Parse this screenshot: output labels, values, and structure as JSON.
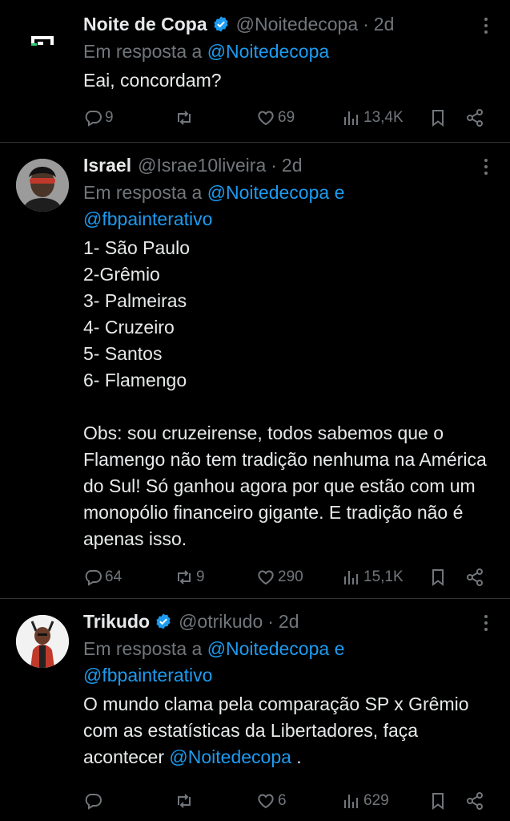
{
  "tweets": [
    {
      "name": "Noite de Copa",
      "verified": true,
      "handle": "@Noitedecopa",
      "time": "2d",
      "reply_prefix": "Em resposta a",
      "reply_mentions": "@Noitedecopa",
      "reply_mentions_2": "",
      "body": "Eai, concordam?",
      "body_mention": "",
      "body_suffix": "",
      "replies": "9",
      "retweets": "",
      "likes": "69",
      "views": "13,4K",
      "avatar_icon": "noite-de-copa-logo"
    },
    {
      "name": "Israel",
      "verified": false,
      "handle": "@Israe10liveira",
      "time": "2d",
      "reply_prefix": "Em resposta a",
      "reply_mentions": "@Noitedecopa e",
      "reply_mentions_2": "@fbpainterativo",
      "body": "1- São Paulo\n2-Grêmio\n3- Palmeiras\n4- Cruzeiro\n5- Santos\n6- Flamengo\n\nObs: sou cruzeirense, todos sabemos que o Flamengo não tem tradição nenhuma na América do Sul! Só ganhou agora por que estão com um monopólio financeiro gigante. E tradição não é apenas isso.",
      "body_mention": "",
      "body_suffix": "",
      "replies": "64",
      "retweets": "9",
      "likes": "290",
      "views": "15,1K",
      "avatar_icon": "user-photo"
    },
    {
      "name": "Trikudo",
      "verified": true,
      "handle": "@otrikudo",
      "time": "2d",
      "reply_prefix": "Em resposta a",
      "reply_mentions": "@Noitedecopa e",
      "reply_mentions_2": "@fbpainterativo",
      "body": "O mundo clama pela comparação SP x Grêmio com as estatísticas da Libertadores, faça acontecer ",
      "body_mention": "@Noitedecopa",
      "body_suffix": " .",
      "replies": "",
      "retweets": "",
      "likes": "6",
      "views": "629",
      "avatar_icon": "devil-mascot"
    }
  ],
  "colors": {
    "background": "#000000",
    "text": "#e7e9ea",
    "muted": "#71767b",
    "link": "#1d9bf0",
    "verified": "#1d9bf0",
    "divider": "#2f3336"
  }
}
